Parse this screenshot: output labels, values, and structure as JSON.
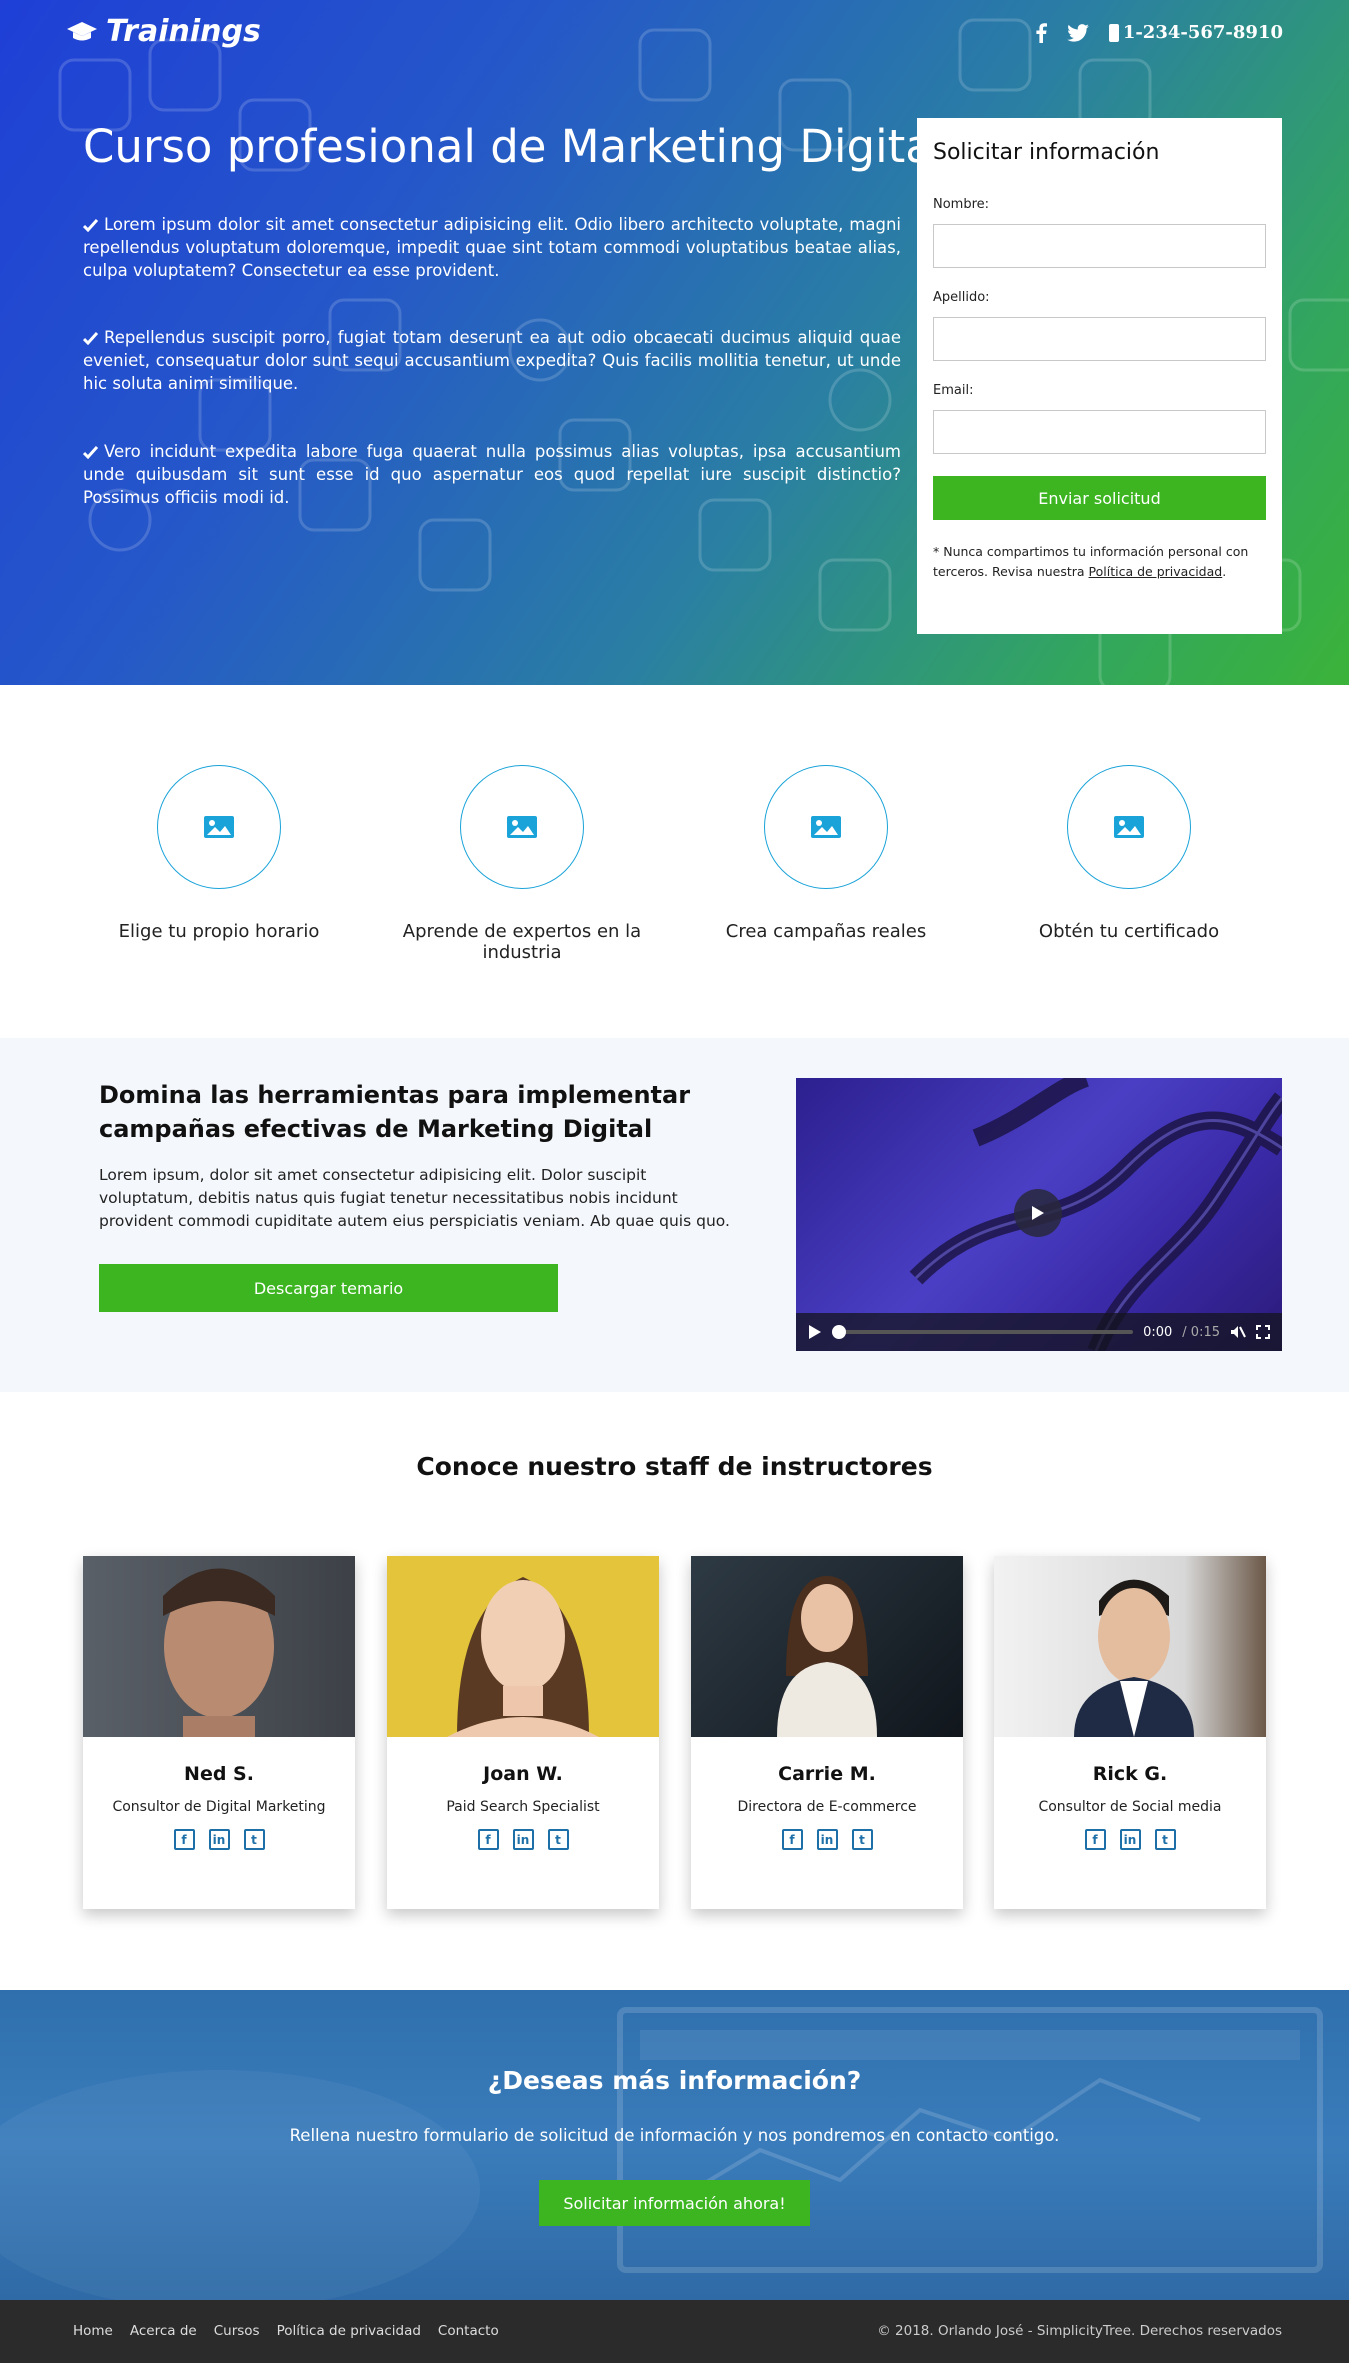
{
  "header": {
    "brand": "Trainings",
    "phone": "1-234-567-8910",
    "icons": [
      "graduation-cap-icon",
      "facebook-icon",
      "twitter-icon",
      "phone-icon"
    ]
  },
  "hero": {
    "title": "Curso profesional de Marketing Digital",
    "bullets": [
      "Lorem ipsum dolor sit amet consectetur adipisicing elit. Odio libero architecto voluptate, magni repellendus voluptatum doloremque, impedit quae sint totam commodi voluptatibus beatae alias, culpa voluptatem? Consectetur ea esse provident.",
      "Repellendus suscipit porro, fugiat totam deserunt ea aut odio obcaecati ducimus aliquid quae eveniet, consequatur dolor sunt sequi accusantium expedita? Quis facilis mollitia tenetur, ut unde hic soluta animi similique.",
      "Vero incidunt expedita labore fuga quaerat nulla possimus alias voluptas, ipsa accusantium unde quibusdam sit sunt esse id quo aspernatur eos quod repellat iure suscipit distinctio? Possimus officiis modi id."
    ]
  },
  "form": {
    "title": "Solicitar información",
    "name_label": "Nombre:",
    "lastname_label": "Apellido:",
    "email_label": "Email:",
    "name_value": "",
    "lastname_value": "",
    "email_value": "",
    "submit": "Enviar solicitud",
    "note_prefix": "* Nunca compartimos tu información personal con terceros. Revisa nuestra ",
    "note_link": "Política de privacidad",
    "note_suffix": "."
  },
  "features": [
    {
      "label": "Elige tu propio horario",
      "icon": "image-icon"
    },
    {
      "label": "Aprende de expertos en la industria",
      "icon": "image-icon"
    },
    {
      "label": "Crea campañas reales",
      "icon": "image-icon"
    },
    {
      "label": "Obtén tu certificado",
      "icon": "image-icon"
    }
  ],
  "course": {
    "title": "Domina las herramientas para implementar campañas efectivas de Marketing Digital",
    "description": "Lorem ipsum, dolor sit amet consectetur adipisicing elit. Dolor suscipit voluptatum, debitis natus quis fugiat tenetur necessitatibus nobis incidunt provident commodi cupiditate autem eius perspiciatis veniam. Ab quae quis quo.",
    "button": "Descargar temario",
    "video": {
      "current": "0:00",
      "total": "/ 0:15",
      "progress": 0
    }
  },
  "staff": {
    "title": "Conoce nuestro staff de instructores",
    "members": [
      {
        "name": "Ned S.",
        "role": "Consultor de Digital Marketing"
      },
      {
        "name": "Joan W.",
        "role": "Paid Search Specialist"
      },
      {
        "name": "Carrie M.",
        "role": "Directora de E-commerce"
      },
      {
        "name": "Rick G.",
        "role": "Consultor de Social media"
      }
    ],
    "social_glyphs": {
      "facebook": "f",
      "linkedin": "in",
      "twitter": "t"
    }
  },
  "cta": {
    "title": "¿Deseas más información?",
    "text": "Rellena nuestro formulario de solicitud de información y nos pondremos en contacto contigo.",
    "button": "Solicitar información ahora!"
  },
  "footer": {
    "links": [
      "Home",
      "Acerca de",
      "Cursos",
      "Política de privacidad",
      "Contacto"
    ],
    "copyright": "© 2018. Orlando José - SimplicityTree. Derechos reservados"
  },
  "colors": {
    "accent_green": "#3cb521",
    "icon_blue": "#1aa3d9",
    "footer_bg": "#2b2b2b",
    "social_blue": "#1d6fa8"
  }
}
